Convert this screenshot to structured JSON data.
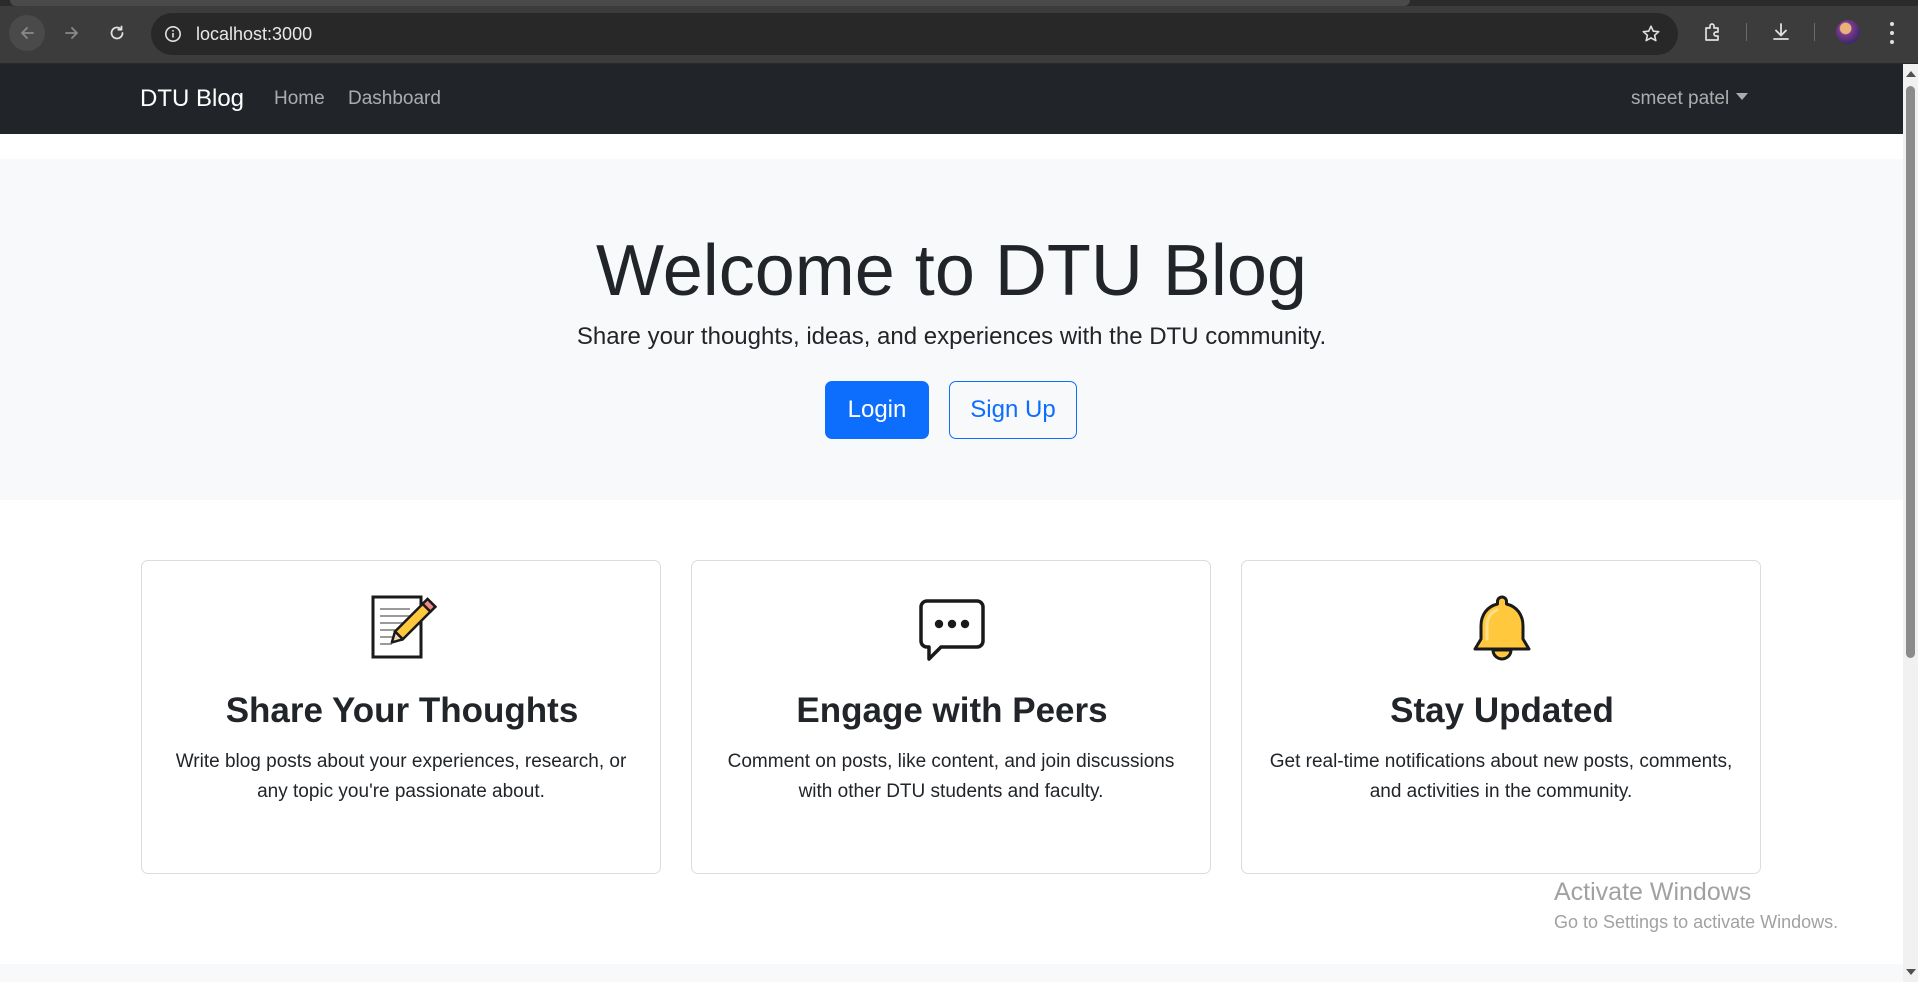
{
  "browser": {
    "url": "localhost:3000"
  },
  "navbar": {
    "brand": "DTU Blog",
    "links": [
      "Home",
      "Dashboard"
    ],
    "user": "smeet patel"
  },
  "hero": {
    "title": "Welcome to DTU Blog",
    "subtitle": "Share your thoughts, ideas, and experiences with the DTU community.",
    "login_label": "Login",
    "signup_label": "Sign Up"
  },
  "features": [
    {
      "icon": "memo-pencil-icon",
      "title": "Share Your Thoughts",
      "text": "Write blog posts about your experiences, research, or any topic you're passionate about."
    },
    {
      "icon": "speech-bubble-icon",
      "title": "Engage with Peers",
      "text": "Comment on posts, like content, and join discussions with other DTU students and faculty."
    },
    {
      "icon": "bell-icon",
      "title": "Stay Updated",
      "text": "Get real-time notifications about new posts, comments, and activities in the community."
    }
  ],
  "watermark": {
    "title": "Activate Windows",
    "subtitle": "Go to Settings to activate Windows."
  },
  "colors": {
    "primary": "#0d6efd",
    "navbar_bg": "#212529",
    "hero_bg": "#f8f9fa",
    "bell": "#ffc83d"
  }
}
